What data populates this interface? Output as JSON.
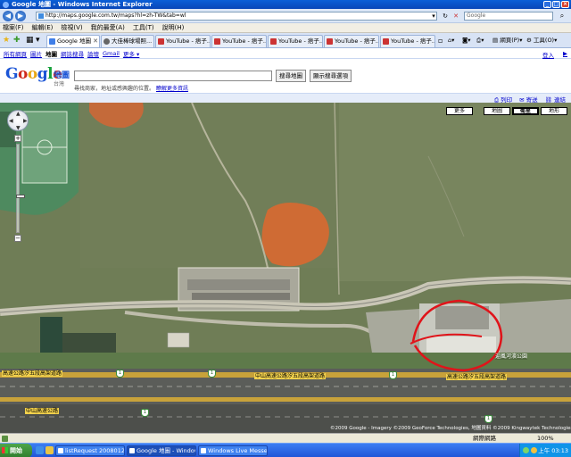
{
  "window": {
    "title": "Google 地圖 - Windows Internet Explorer"
  },
  "address_bar": {
    "url": "http://maps.google.com.tw/maps?hl=zh-TW&tab=wl",
    "search_placeholder": "Google"
  },
  "menu": [
    "檔案(F)",
    "編輯(E)",
    "檢視(V)",
    "我的最愛(A)",
    "工具(T)",
    "說明(H)"
  ],
  "tabs": [
    {
      "label": "Google 地圖",
      "kind": "google",
      "active": true
    },
    {
      "label": "大佳棒球場照...",
      "kind": "cup",
      "active": false
    },
    {
      "label": "YouTube - 痞子...",
      "kind": "youtube",
      "active": false
    },
    {
      "label": "YouTube - 痞子...",
      "kind": "youtube",
      "active": false
    },
    {
      "label": "YouTube - 痞子...",
      "kind": "youtube",
      "active": false
    },
    {
      "label": "YouTube - 痞子...",
      "kind": "youtube",
      "active": false
    },
    {
      "label": "YouTube - 痞子...",
      "kind": "youtube",
      "active": false
    }
  ],
  "commands": {
    "page": "網頁(P)",
    "tools": "工具(O)"
  },
  "google": {
    "nav_links": [
      "所有網頁",
      "圖片",
      "地圖",
      "網誌搜尋",
      "論壇",
      "Gmail",
      "更多 ▾"
    ],
    "current_nav": "地圖",
    "right_links": [
      "登入",
      "▶"
    ],
    "logo": {
      "b1": "G",
      "r1": "o",
      "y": "o",
      "b2": "g",
      "gr": "l",
      "r2": "e"
    },
    "product": "地圖",
    "region": "台灣",
    "search_button": "搜尋地圖",
    "options_button": "顯示搜尋選項",
    "hint_text": "尋找商家，地址或感興趣的位置。",
    "hint_link": "瞭解更多資訊",
    "tools": [
      "列印",
      "寄送",
      "連結"
    ]
  },
  "map": {
    "more_button": "更多",
    "map_types": [
      "地圖",
      "衛星",
      "地形"
    ],
    "selected_type": "衛星",
    "zoom_level_fraction": 0.58,
    "labels": {
      "highway_left": "高速公路汐五段高架道路",
      "highway_mid": "中山高速公路汐五段高架道路",
      "highway_right": "高速公路汐五段高架道路",
      "lower_road": "中山高速公路",
      "area": "迎風河濱公園"
    },
    "shield_number": "1",
    "copyright": "©2009 Google - Imagery ©2009 GeoForce Technologies, 地圖資料 ©2009 Kingwaytek Technologies - 使用條款"
  },
  "status_bar": {
    "zone": "網際網路",
    "zoom": "100%"
  },
  "taskbar": {
    "start": "開始",
    "tasks": [
      {
        "label": "listRequest 20080124-1 ...",
        "active": false
      },
      {
        "label": "Google 地圖 - Windows I...",
        "active": true
      },
      {
        "label": "Windows Live Messenger",
        "active": false
      }
    ],
    "clock": "上午 03:13"
  }
}
